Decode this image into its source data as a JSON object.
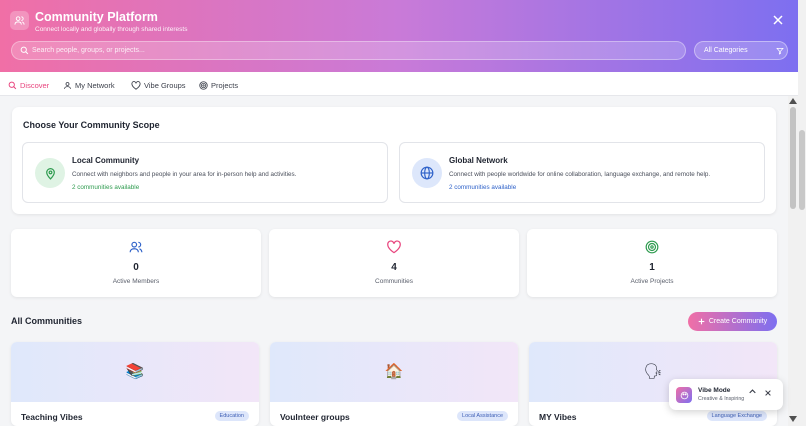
{
  "header": {
    "title": "Community Platform",
    "subtitle": "Connect locally and globally through shared interests",
    "search_placeholder": "Search people, groups, or projects...",
    "category_value": "All Categories"
  },
  "tabs": [
    {
      "label": "Discover",
      "icon": "search-icon",
      "active": true
    },
    {
      "label": "My Network",
      "icon": "user-icon",
      "active": false
    },
    {
      "label": "Vibe Groups",
      "icon": "heart-icon",
      "active": false
    },
    {
      "label": "Projects",
      "icon": "target-icon",
      "active": false
    }
  ],
  "scope": {
    "title": "Choose Your Community Scope",
    "options": [
      {
        "title": "Local Community",
        "description": "Connect with neighbors and people in your area for in-person help and activities.",
        "count": "2 communities available",
        "icon": "map-pin-icon",
        "color": "#2e9b4f"
      },
      {
        "title": "Global Network",
        "description": "Connect with people worldwide for online collaboration, language exchange, and remote help.",
        "count": "2 communities available",
        "icon": "globe-icon",
        "color": "#2f62c9"
      }
    ]
  },
  "stats": [
    {
      "value": "0",
      "label": "Active Members",
      "icon": "users-icon"
    },
    {
      "value": "4",
      "label": "Communities",
      "icon": "heart-icon"
    },
    {
      "value": "1",
      "label": "Active Projects",
      "icon": "target-icon"
    }
  ],
  "communities_section": {
    "title": "All Communities",
    "create_label": "Create Community"
  },
  "communities": [
    {
      "name": "Teaching Vibes",
      "tag": "Education",
      "emoji": "📚"
    },
    {
      "name": "Voulnteer groups",
      "tag": "Local Assistance",
      "emoji": "🏠"
    },
    {
      "name": "MY Vibes",
      "tag": "Language Exchange",
      "emoji": "🗣"
    }
  ],
  "vibe_mode": {
    "title": "Vibe Mode",
    "subtitle": "Creative & Inspiring"
  },
  "colors": {
    "accent_pink": "#e8457e",
    "accent_purple": "#7d6ff0",
    "local_green": "#2e9b4f",
    "global_blue": "#2f62c9"
  }
}
